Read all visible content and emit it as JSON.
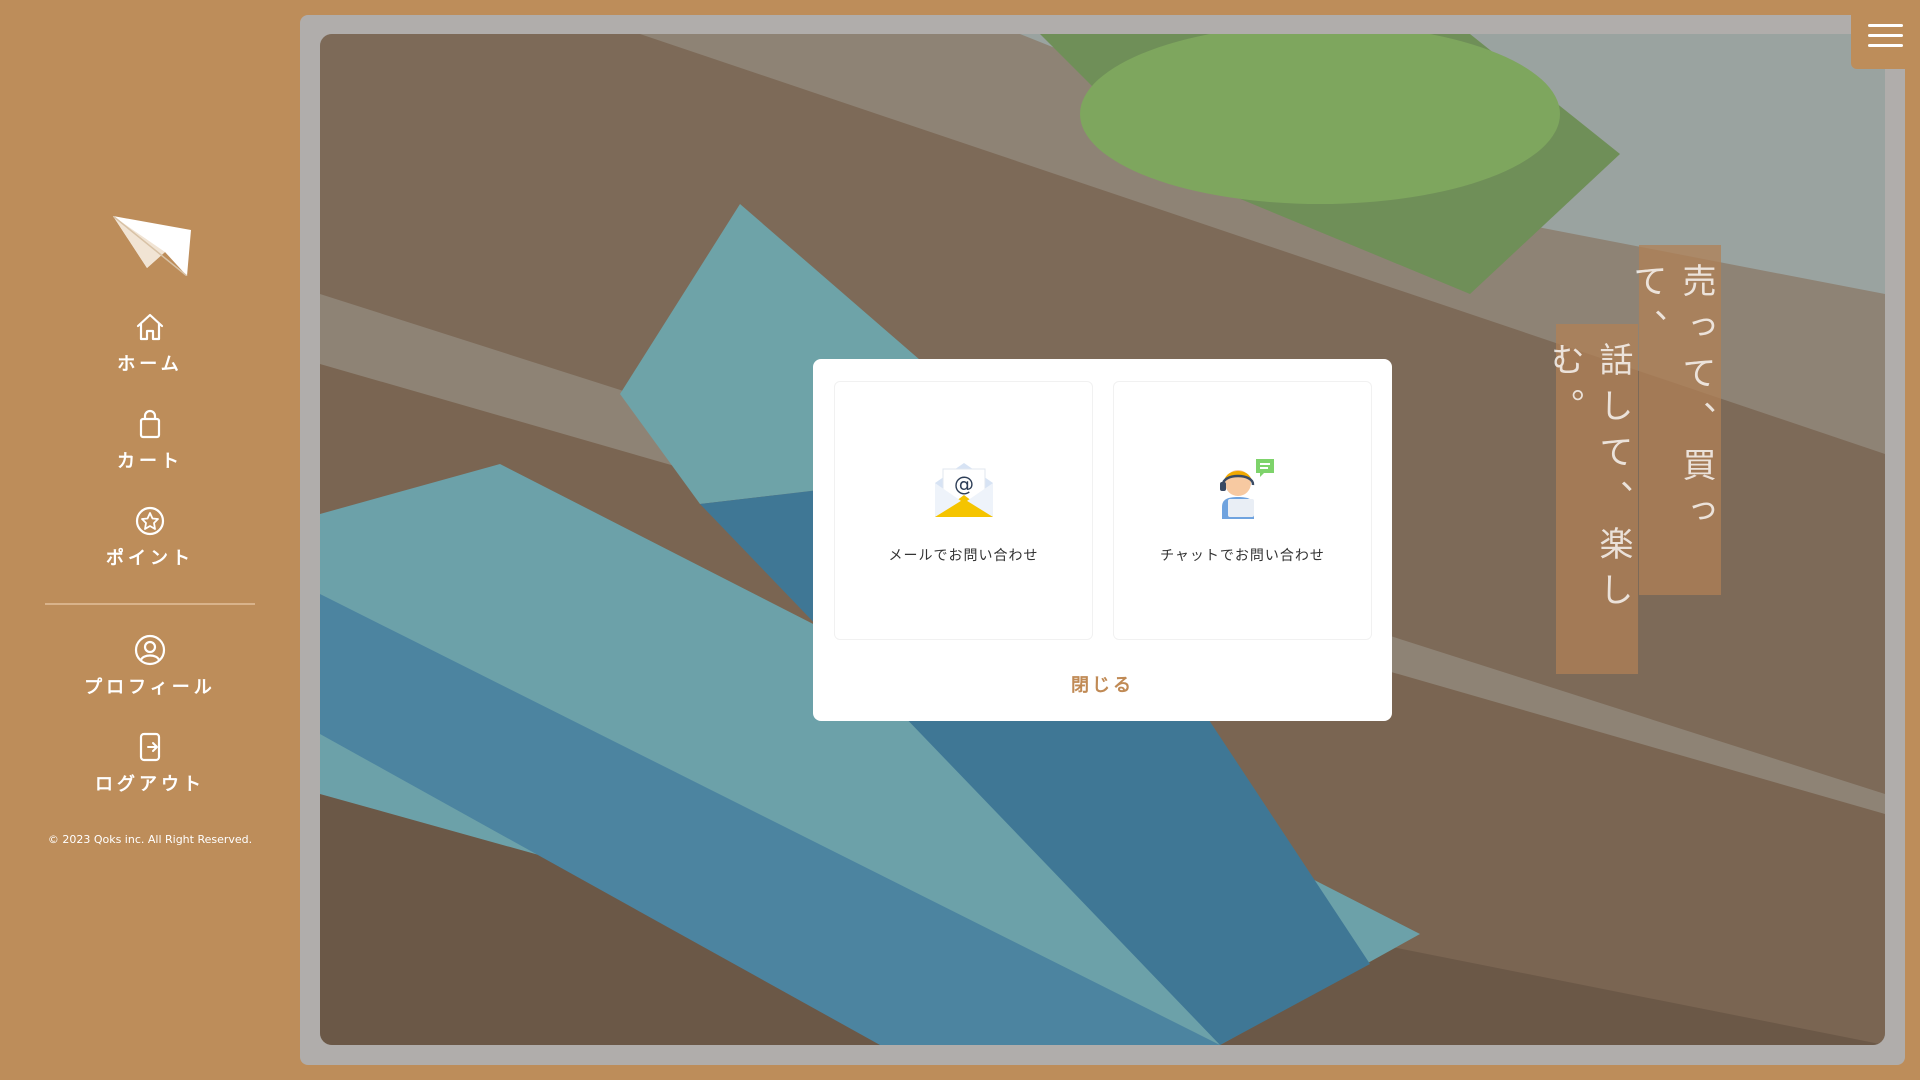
{
  "sidebar": {
    "logo_icon": "paper-plane-logo",
    "items": [
      {
        "label": "ホーム",
        "icon": "home-icon"
      },
      {
        "label": "カート",
        "icon": "shopping-bag-icon"
      },
      {
        "label": "ポイント",
        "icon": "point-star-icon"
      },
      {
        "label": "プロフィール",
        "icon": "user-circle-icon"
      },
      {
        "label": "ログアウト",
        "icon": "logout-icon"
      }
    ],
    "copyright": "© 2023 Qoks inc. All Right Reserved."
  },
  "header": {
    "menu_icon": "hamburger-menu-icon"
  },
  "hero": {
    "tagline_lines": [
      "売って、買って、",
      "話して、楽しむ。"
    ]
  },
  "modal": {
    "options": [
      {
        "label": "メールでお問い合わせ",
        "icon": "email-envelope-icon"
      },
      {
        "label": "チャットでお問い合わせ",
        "icon": "chat-support-agent-icon"
      }
    ],
    "close_label": "閉じる"
  },
  "colors": {
    "brand": "#bd8d5a",
    "frame": "#b0adab",
    "modal_bg": "#ffffff",
    "close_text": "#c08a55"
  }
}
